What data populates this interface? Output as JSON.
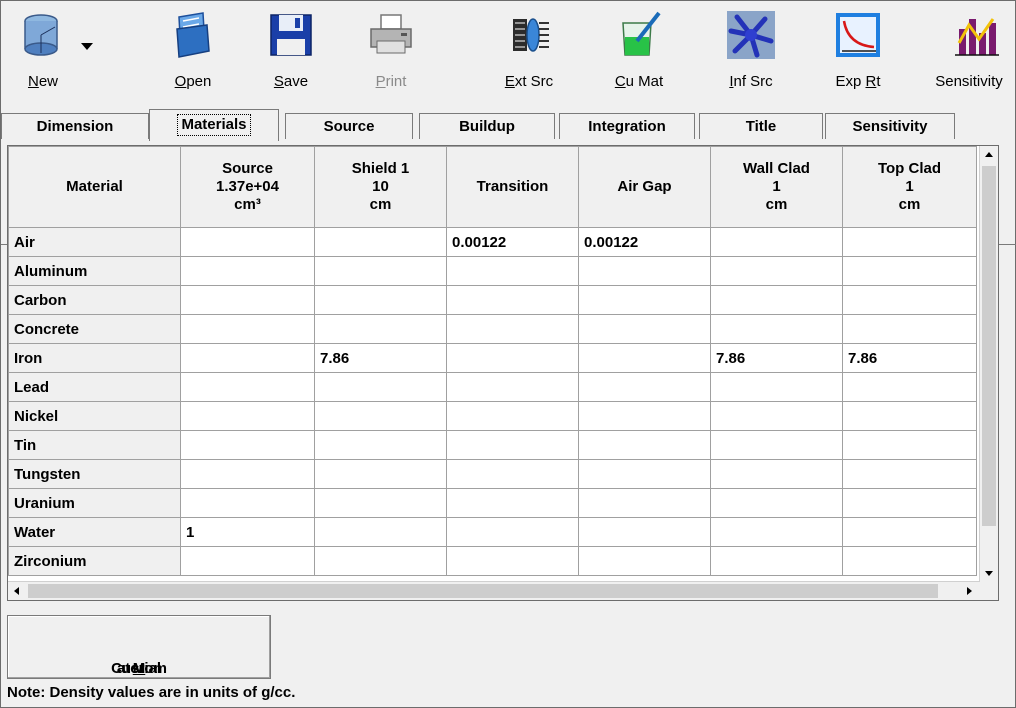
{
  "toolbar": {
    "buttons": [
      {
        "label_pre": "",
        "label_u": "N",
        "label_post": "ew",
        "icon": "new-cylinder-icon"
      },
      {
        "label_pre": "",
        "label_u": "O",
        "label_post": "pen",
        "icon": "open-folder-icon"
      },
      {
        "label_pre": "",
        "label_u": "S",
        "label_post": "ave",
        "icon": "floppy-save-icon"
      },
      {
        "label_pre": "",
        "label_u": "P",
        "label_post": "rint",
        "icon": "printer-icon"
      },
      {
        "label_pre": "",
        "label_u": "E",
        "label_post": "xt Src",
        "icon": "external-source-icon"
      },
      {
        "label_pre": "",
        "label_u": "C",
        "label_post": "u Mat",
        "icon": "beaker-icon"
      },
      {
        "label_pre": "",
        "label_u": "I",
        "label_post": "nf Src",
        "icon": "infinite-source-icon"
      },
      {
        "label_pre": "Exp ",
        "label_u": "R",
        "label_post": "t",
        "icon": "exposure-rate-chart-icon"
      },
      {
        "label_pre": "Sensitivity",
        "label_u": "",
        "label_post": "",
        "icon": "sensitivity-chart-icon"
      }
    ]
  },
  "tabs": [
    "Dimension",
    "Materials",
    "Source",
    "Buildup",
    "Integration",
    "Title",
    "Sensitivity"
  ],
  "active_tab": "Materials",
  "grid": {
    "headers": [
      "Material",
      "Source\n1.37e+04\ncm³",
      "Shield 1\n10\ncm",
      "Transition",
      "Air Gap",
      "Wall Clad\n1\ncm",
      "Top Clad\n1\ncm"
    ],
    "rows": [
      [
        "Air",
        "",
        "",
        "0.00122",
        "0.00122",
        "",
        ""
      ],
      [
        "Aluminum",
        "",
        "",
        "",
        "",
        "",
        ""
      ],
      [
        "Carbon",
        "",
        "",
        "",
        "",
        "",
        ""
      ],
      [
        "Concrete",
        "",
        "",
        "",
        "",
        "",
        ""
      ],
      [
        "Iron",
        "",
        "7.86",
        "",
        "",
        "7.86",
        "7.86"
      ],
      [
        "Lead",
        "",
        "",
        "",
        "",
        "",
        ""
      ],
      [
        "Nickel",
        "",
        "",
        "",
        "",
        "",
        ""
      ],
      [
        "Tin",
        "",
        "",
        "",
        "",
        "",
        ""
      ],
      [
        "Tungsten",
        "",
        "",
        "",
        "",
        "",
        ""
      ],
      [
        "Uranium",
        "",
        "",
        "",
        "",
        "",
        ""
      ],
      [
        "Water",
        "1",
        "",
        "",
        "",
        "",
        ""
      ],
      [
        "Zirconium",
        "",
        "",
        "",
        "",
        "",
        ""
      ]
    ]
  },
  "custom_button": {
    "pre": "Custom ",
    "u": "M",
    "post": "aterial"
  },
  "note": "Note: Density values are in units of g/cc."
}
